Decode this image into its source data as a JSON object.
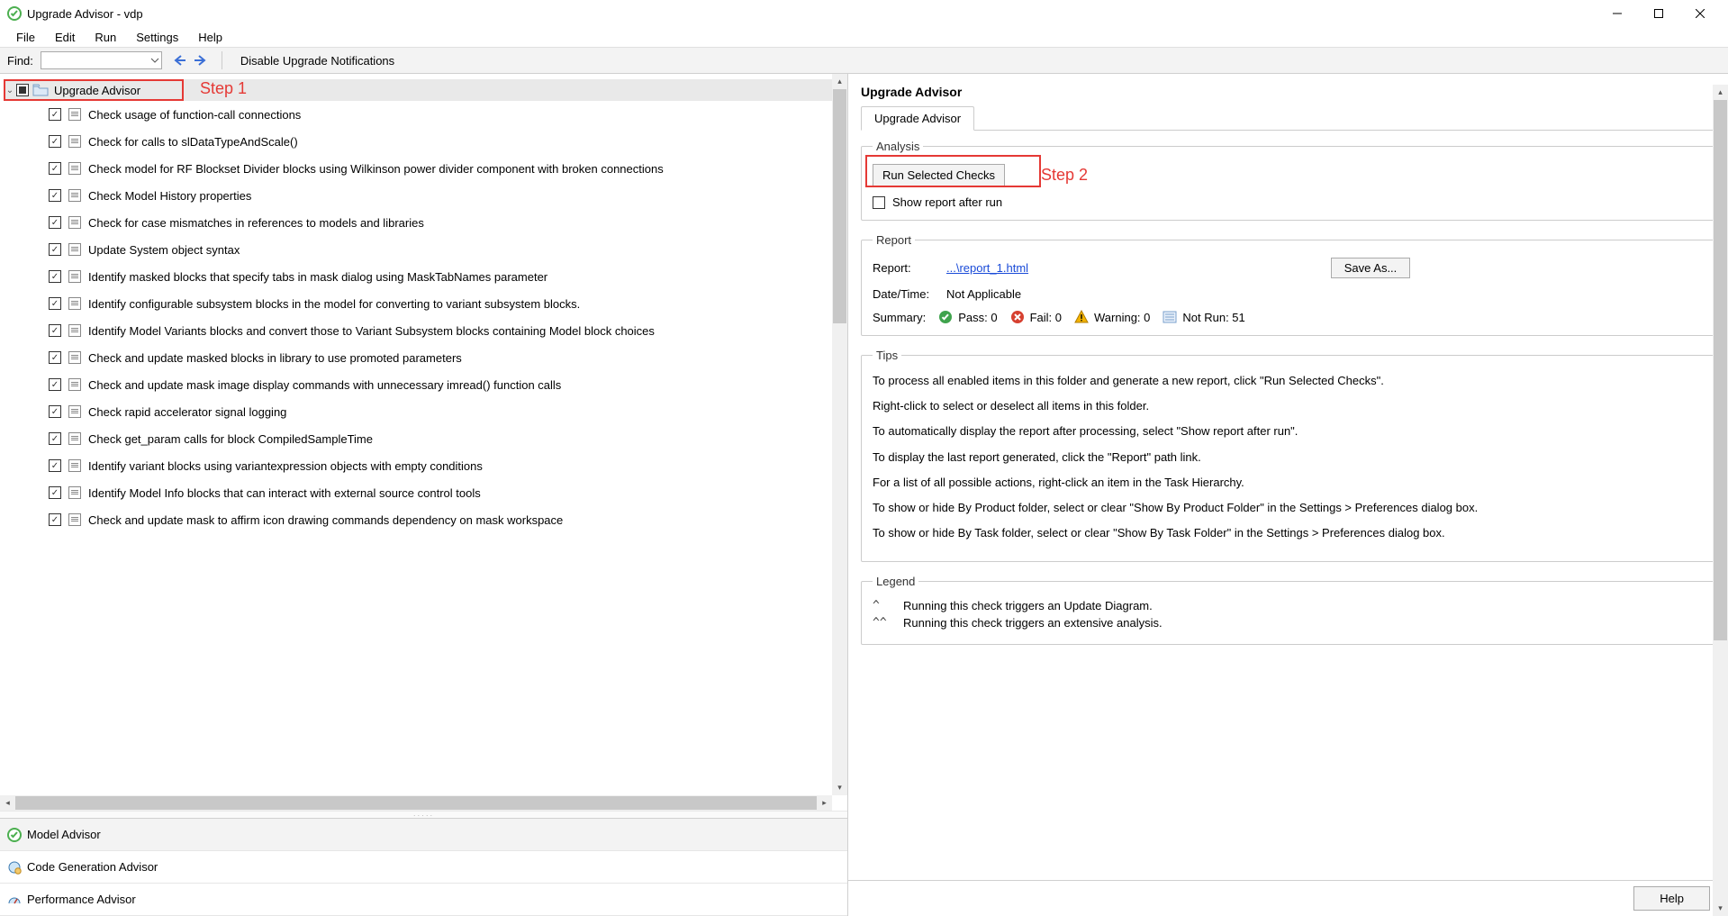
{
  "title": "Upgrade Advisor - vdp",
  "menu": [
    "File",
    "Edit",
    "Run",
    "Settings",
    "Help"
  ],
  "toolbar": {
    "find_label": "Find:",
    "disable": "Disable Upgrade Notifications"
  },
  "tree": {
    "root": "Upgrade Advisor",
    "step1": "Step 1",
    "items": [
      "Check usage of function-call connections",
      "Check for calls to slDataTypeAndScale()",
      "Check model for RF Blockset Divider blocks using Wilkinson power divider component with broken connections",
      "Check Model History properties",
      "Check for case mismatches in references to models and libraries",
      "Update System object syntax",
      "Identify masked blocks that specify tabs in mask dialog using MaskTabNames parameter",
      "Identify configurable subsystem blocks in the model for converting to variant subsystem blocks.",
      "Identify Model Variants blocks and convert those to Variant Subsystem blocks containing Model block choices",
      "Check and update masked blocks in library to use promoted parameters",
      "Check and update mask image display commands with unnecessary imread() function calls",
      "Check rapid accelerator signal logging",
      "Check get_param calls for block CompiledSampleTime",
      "Identify variant blocks using variantexpression objects with empty conditions",
      "Identify Model Info blocks that can interact with external source control tools",
      "Check and update mask to affirm icon drawing commands dependency on mask workspace"
    ]
  },
  "advisors": {
    "model": "Model Advisor",
    "codegen": "Code Generation Advisor",
    "perf": "Performance Advisor"
  },
  "right": {
    "header": "Upgrade Advisor",
    "tab": "Upgrade Advisor",
    "analysis": {
      "legend": "Analysis",
      "run": "Run Selected Checks",
      "step2": "Step 2",
      "show": "Show report after run"
    },
    "report": {
      "legend": "Report",
      "label": "Report:",
      "link": "...\\report_1.html",
      "saveas": "Save As...",
      "dt_label": "Date/Time:",
      "dt_value": "Not Applicable",
      "summary_label": "Summary:",
      "pass": "Pass: 0",
      "fail": "Fail: 0",
      "warn": "Warning: 0",
      "notrun": "Not Run: 51"
    },
    "tips": {
      "legend": "Tips",
      "p1": "To process all enabled items in this folder and generate a new report, click \"Run Selected Checks\".",
      "p2": "Right-click to select or deselect all items in this folder.",
      "p3": "To automatically display the report after processing, select \"Show report after run\".",
      "p4": "To display the last report generated, click the \"Report\" path link.",
      "p5": "For a list of all possible actions, right-click an item in the Task Hierarchy.",
      "p6": "To show or hide By Product folder, select or clear \"Show By Product Folder\" in the Settings > Preferences dialog box.",
      "p7": "To show or hide By Task folder, select or clear \"Show By Task Folder\" in the Settings > Preferences dialog box."
    },
    "legend_box": {
      "legend": "Legend",
      "l1": "Running this check triggers an Update Diagram.",
      "l2": "Running this check triggers an extensive analysis."
    }
  },
  "footer": {
    "help": "Help"
  }
}
